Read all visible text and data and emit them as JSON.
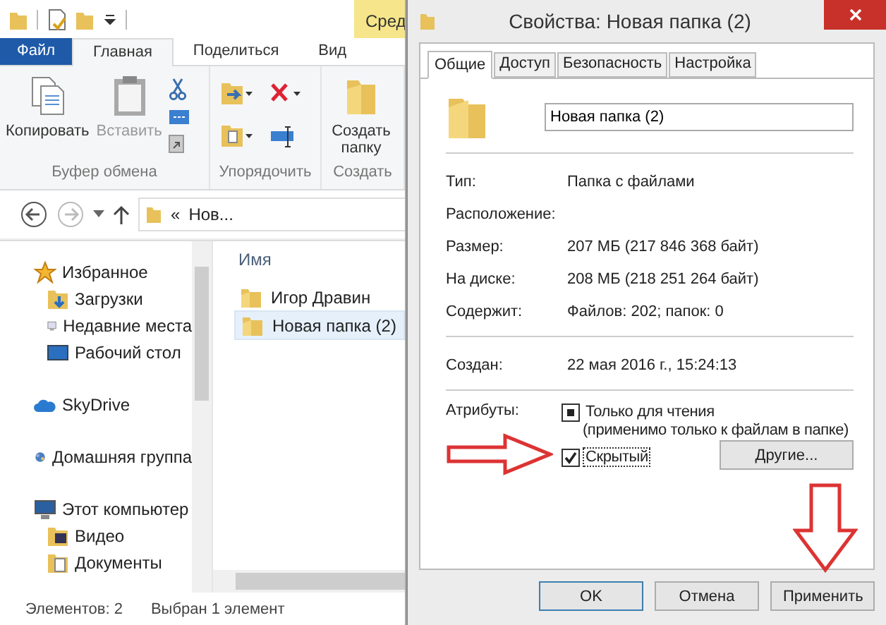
{
  "explorer": {
    "context_tab": "Сред",
    "ribbon_tabs": [
      {
        "label": "Файл",
        "kind": "file",
        "selected": false
      },
      {
        "label": "Главная",
        "kind": "tab",
        "selected": true
      },
      {
        "label": "Поделиться",
        "kind": "tab",
        "selected": false
      },
      {
        "label": "Вид",
        "kind": "tab",
        "selected": false
      }
    ],
    "ribbon_groups": [
      {
        "kind": "clipboard",
        "label": "Буфер обмена",
        "buttons": [
          {
            "label": "Копировать",
            "kind": "copy",
            "disabled": false
          },
          {
            "label": "Вставить",
            "kind": "paste",
            "disabled": true
          }
        ]
      },
      {
        "kind": "organize",
        "label": "Упорядочить"
      },
      {
        "kind": "new",
        "label": "Создать",
        "buttons": [
          {
            "label": "Создать папку",
            "kind": "folder",
            "disabled": false
          }
        ]
      }
    ],
    "address": {
      "separator": "«",
      "path": "Нов..."
    },
    "nav_pane": [
      {
        "label": "Избранное",
        "kind": "star",
        "children": [
          {
            "label": "Загрузки",
            "kind": "downloads"
          },
          {
            "label": "Недавние места",
            "kind": "recent"
          },
          {
            "label": "Рабочий стол",
            "kind": "desktop"
          }
        ]
      },
      {
        "label": "SkyDrive",
        "kind": "cloud"
      },
      {
        "label": "Домашняя группа",
        "kind": "homegroup"
      },
      {
        "label": "Этот компьютер",
        "kind": "computer",
        "children": [
          {
            "label": "Видео",
            "kind": "video"
          },
          {
            "label": "Документы",
            "kind": "docs"
          }
        ]
      }
    ],
    "column": "Имя",
    "items": [
      {
        "name": "Игор Дравин",
        "selected": false
      },
      {
        "name": "Новая папка (2)",
        "selected": true
      }
    ],
    "status_bar": [
      "Элементов: 2",
      "Выбран 1 элемент"
    ]
  },
  "dialog": {
    "title": "Свойства: Новая папка (2)",
    "tabs": [
      {
        "label": "Общие",
        "selected": true
      },
      {
        "label": "Доступ",
        "selected": false
      },
      {
        "label": "Безопасность",
        "selected": false
      },
      {
        "label": "Настройка",
        "selected": false
      }
    ],
    "name_field": "Новая папка (2)",
    "sections": [
      [
        {
          "label": "Тип:",
          "value": "Папка с файлами"
        },
        {
          "label": "Расположение:"
        },
        {
          "label": "Размер:",
          "value": "207 МБ (217 846 368 байт)"
        },
        {
          "label": "На диске:",
          "value": "208 МБ (218 251 264 байт)"
        },
        {
          "label": "Содержит:",
          "value": "Файлов: 202; папок: 0"
        }
      ],
      [
        {
          "label": "Создан:",
          "value": "22 мая 2016 г., 15:24:13"
        }
      ]
    ],
    "attributes_label": "Атрибуты:",
    "attributes": [
      {
        "label": "Только для чтения",
        "note": "(применимо только к файлам в папке)",
        "indeterminate": true,
        "focused": false
      },
      {
        "label": "Скрытый",
        "checked": true,
        "focused": true
      }
    ],
    "other_button": "Другие...",
    "buttons": [
      {
        "label": "OK",
        "default": true
      },
      {
        "label": "Отмена",
        "default": false
      },
      {
        "label": "Применить",
        "default": false
      }
    ]
  }
}
